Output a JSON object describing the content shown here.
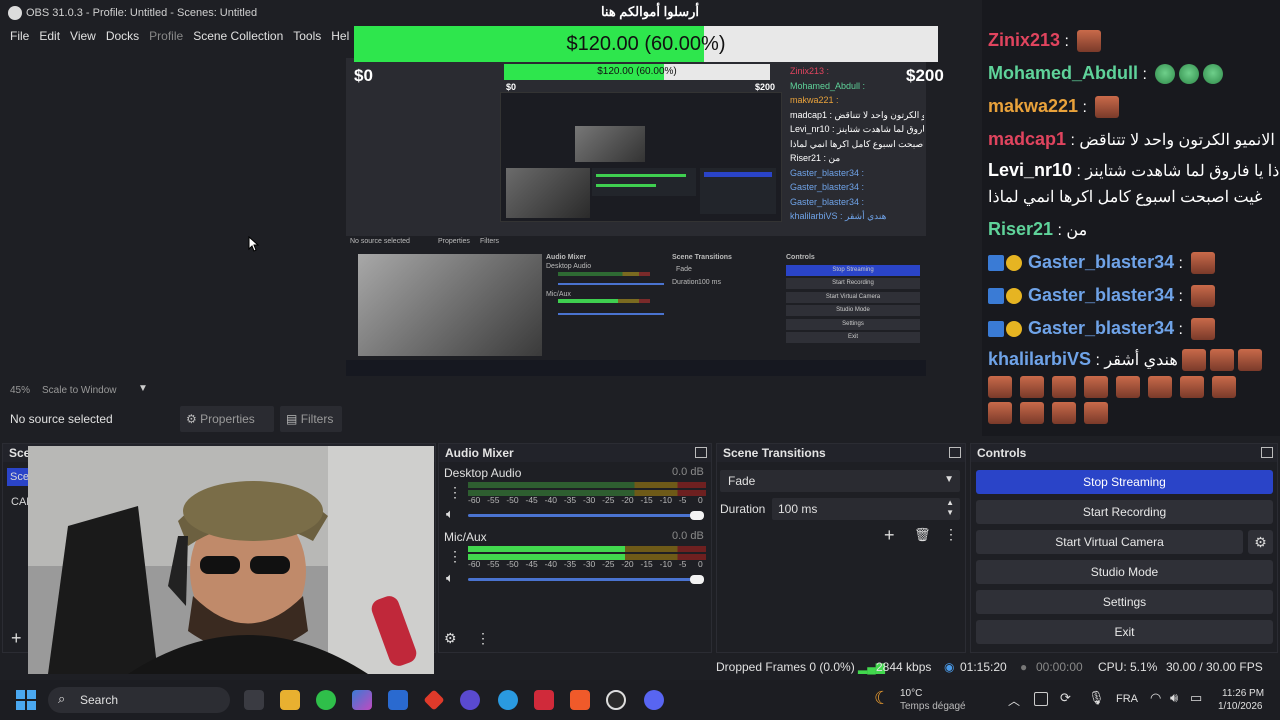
{
  "window": {
    "title": "OBS 31.0.3 - Profile: Untitled - Scenes: Untitled",
    "minimize": "—",
    "maximize": "☐",
    "close": "✕"
  },
  "menu": {
    "file": "File",
    "edit": "Edit",
    "view": "View",
    "docks": "Docks",
    "profile": "Profile",
    "scene_collection": "Scene Collection",
    "tools": "Tools",
    "help": "Hel"
  },
  "donation": {
    "heading": "أرسلوا أموالكم هنا",
    "label": "$120.00 (60.00%)",
    "progress": 0.6,
    "min": "$0",
    "max": "$200"
  },
  "nested": {
    "label": "$120.00 (60.00%)",
    "min": "$0",
    "max": "$200",
    "no_source": "No source selected",
    "properties": "Properties",
    "filters": "Filters",
    "audio_mixer": "Audio Mixer",
    "desktop_audio": "Desktop Audio",
    "mic_aux": "Mic/Aux",
    "scene_transitions": "Scene Transitions",
    "fade": "Fade",
    "duration": "Duration",
    "duration_val": "100 ms",
    "controls": "Controls",
    "buttons": [
      "Stop Streaming",
      "Start Recording",
      "Start Virtual Camera",
      "Studio Mode",
      "Settings",
      "Exit"
    ],
    "chat": [
      "Zinix213 :",
      "Mohamed_Abdull :",
      "makwa221 :",
      "madcap1 : الانميو الكرتون واحد لا تتناقض",
      "Levi_nr10 : لماذا يا فاروق لما شاهدت شتاينز",
      "غيت اصبحت اسبوع كامل اكرها انمي لماذا",
      "Riser21 : من",
      "Gaster_blaster34 :",
      "Gaster_blaster34 :",
      "Gaster_blaster34 :",
      "khalilarbiVS : هندي أشقر"
    ]
  },
  "chat": [
    {
      "user": "Zinix213",
      "color": "#e0445e",
      "sep": " : ",
      "msg": "",
      "emotes": 1,
      "badges": false
    },
    {
      "user": "Mohamed_Abdull",
      "color": "#5fd39a",
      "sep": " : ",
      "msg": "",
      "emotes": 3,
      "face": true,
      "badges": false
    },
    {
      "user": "makwa221",
      "color": "#e9a23b",
      "sep": " : ",
      "msg": "",
      "emotes": 1,
      "badges": false
    },
    {
      "user": "madcap1",
      "color": "#e0445e",
      "sep": " : ",
      "msg": "الانميو الكرتون واحد لا تتناقض",
      "emotes": 0,
      "badges": false
    },
    {
      "user": "Levi_nr10",
      "color": "#ffffff",
      "sep": " : ",
      "msg": "لماذا يا فاروق لما شاهدت شتاينز",
      "emotes": 0,
      "badges": false
    },
    {
      "user": "",
      "color": "#ffffff",
      "sep": "",
      "msg": "غيت اصبحت اسبوع كامل اكرها انمي لماذا",
      "emotes": 0,
      "badges": false
    },
    {
      "user": "Riser21",
      "color": "#5fd39a",
      "sep": " : ",
      "msg": "من",
      "emotes": 0,
      "badges": false
    },
    {
      "user": "Gaster_blaster34",
      "color": "#6fa3e8",
      "sep": " : ",
      "msg": "",
      "emotes": 1,
      "badges": true
    },
    {
      "user": "Gaster_blaster34",
      "color": "#6fa3e8",
      "sep": " : ",
      "msg": "",
      "emotes": 1,
      "badges": true
    },
    {
      "user": "Gaster_blaster34",
      "color": "#6fa3e8",
      "sep": " : ",
      "msg": "",
      "emotes": 1,
      "badges": true
    },
    {
      "user": "khalilarbiVS",
      "color": "#6fa3e8",
      "sep": " : ",
      "msg": "هندي أشقر",
      "emotes": 3,
      "badges": false
    }
  ],
  "preview": {
    "zoom": "45%",
    "scale_mode": "Scale to Window"
  },
  "source_toolbar": {
    "no_source": "No source selected",
    "properties": "Properties",
    "filters": "Filters"
  },
  "scenes_dock": {
    "title": "Scene",
    "item1": "Sce",
    "item2": "CAM"
  },
  "audio_mixer": {
    "title": "Audio Mixer",
    "channels": [
      {
        "name": "Desktop Audio",
        "db": "0.0 dB",
        "level": 0.0,
        "volume": 1.0
      },
      {
        "name": "Mic/Aux",
        "db": "0.0 dB",
        "level": 0.62,
        "volume": 1.0
      }
    ],
    "scale": [
      "-60",
      "-55",
      "-50",
      "-45",
      "-40",
      "-35",
      "-30",
      "-25",
      "-20",
      "-15",
      "-10",
      "-5",
      "0"
    ]
  },
  "transitions": {
    "title": "Scene Transitions",
    "selected": "Fade",
    "duration_label": "Duration",
    "duration_value": "100 ms"
  },
  "controls": {
    "title": "Controls",
    "stop_streaming": "Stop Streaming",
    "start_recording": "Start Recording",
    "start_virtual_camera": "Start Virtual Camera",
    "studio_mode": "Studio Mode",
    "settings": "Settings",
    "exit": "Exit"
  },
  "status": {
    "dropped_frames": "Dropped Frames 0 (0.0%)",
    "bitrate": "2844 kbps",
    "stream_time": "01:15:20",
    "record_time": "00:00:00",
    "cpu": "CPU: 5.1%",
    "fps": "30.00 / 30.00 FPS"
  },
  "taskbar": {
    "search": "Search",
    "temperature": "10°C",
    "weather": "Temps dégagé",
    "language": "FRA",
    "time": "11:26 PM",
    "date": "1/10/2026"
  },
  "colors": {
    "accent": "#2a44c8",
    "green_bar": "#2ee64d",
    "bg": "#1e1f24"
  }
}
